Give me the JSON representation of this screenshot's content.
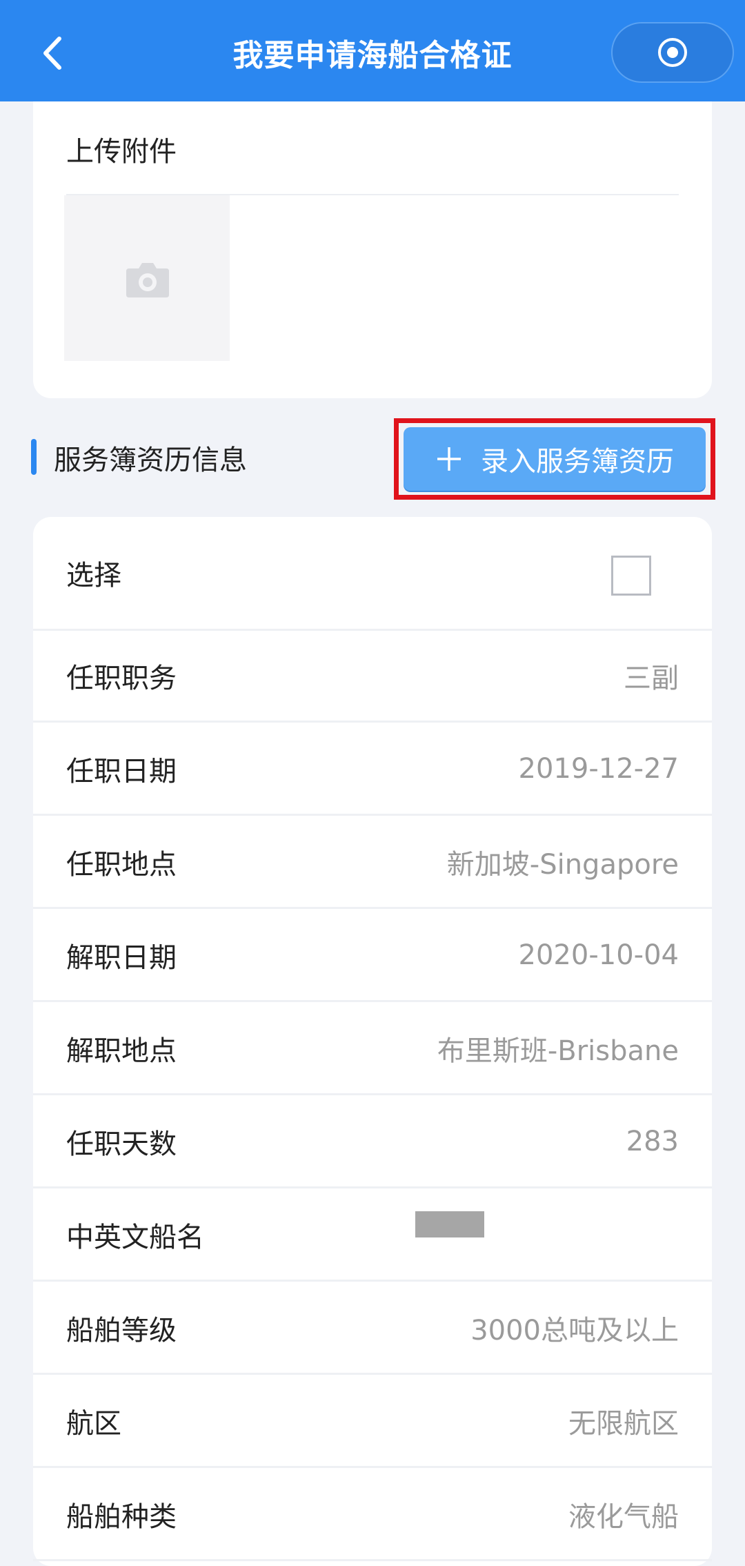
{
  "header": {
    "title": "我要申请海船合格证",
    "bg_color": "#2b87f0"
  },
  "upload": {
    "title": "上传附件"
  },
  "service_section": {
    "title": "服务簿资历信息",
    "add_button_label": "录入服务簿资历",
    "highlight_color": "#e0131c"
  },
  "record": {
    "select_label": "选择",
    "rows": [
      {
        "label": "任职职务",
        "value": "三副"
      },
      {
        "label": "任职日期",
        "value": "2019-12-27"
      },
      {
        "label": "任职地点",
        "value": "新加坡-Singapore"
      },
      {
        "label": "解职日期",
        "value": "2020-10-04"
      },
      {
        "label": "解职地点",
        "value": "布里斯班-Brisbane"
      },
      {
        "label": "任职天数",
        "value": "283"
      },
      {
        "label": "中英文船名",
        "value": ""
      },
      {
        "label": "船舶等级",
        "value": "3000总吨及以上"
      },
      {
        "label": "航区",
        "value": "无限航区"
      },
      {
        "label": "船舶种类",
        "value": "液化气船"
      }
    ]
  }
}
